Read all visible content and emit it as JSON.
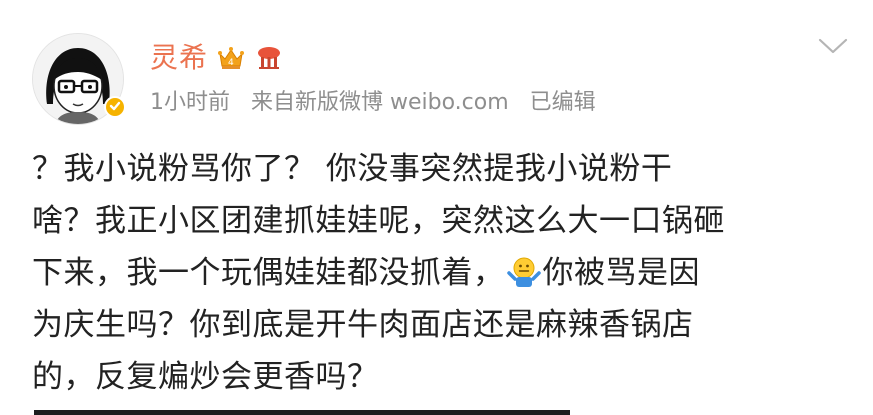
{
  "post": {
    "username": "灵希",
    "meta": {
      "time": "1小时前",
      "source": "来自新版微博 weibo.com",
      "edited": "已编辑"
    },
    "lines": [
      "？我小说粉骂你了？ 你没事突然提我小说粉干",
      "啥？我正小区团建抓娃娃呢，突然这么大一口锅砸",
      "下来，我一个玩偶娃娃都没抓着，",
      "你被骂是因",
      "为庆生吗？你到底是开牛肉面店还是麻辣香锅店",
      "的，反复煸炒会更香吗？"
    ]
  },
  "icons": {
    "avatar": "avatar-girl-with-glasses",
    "verified": "verified-badge-icon",
    "vip": "crown-badge-icon",
    "emoji": "shrug-emoji-icon",
    "menu": "chevron-down-icon"
  },
  "colors": {
    "username": "#eb7350",
    "meta": "#8e8e8e",
    "text": "#222222",
    "verified": "#f6b300"
  }
}
